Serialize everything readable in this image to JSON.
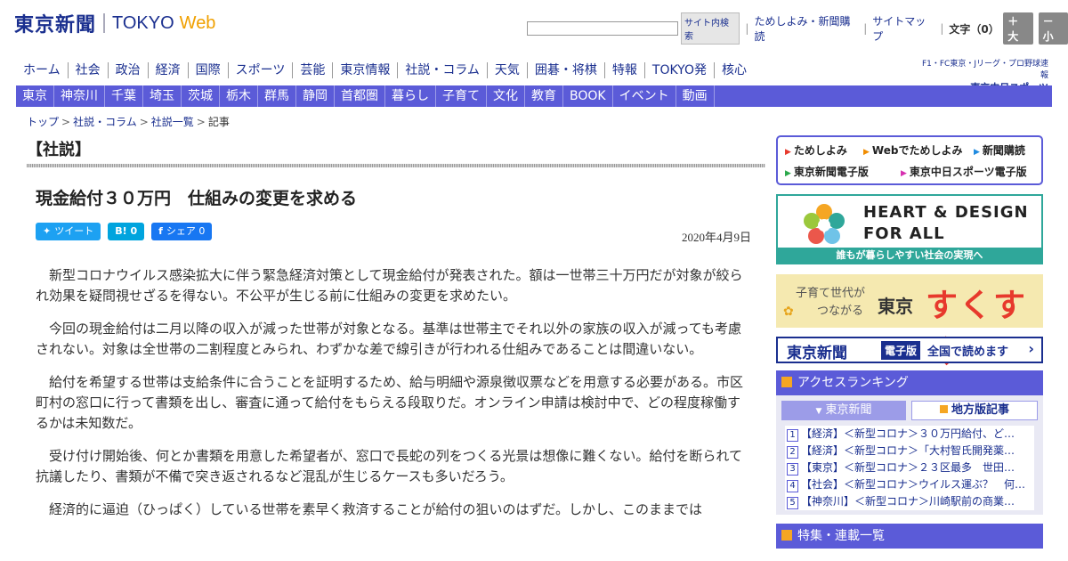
{
  "header": {
    "logo_jp": "東京新聞",
    "logo_tokyo": "TOKYO",
    "logo_web": "Web",
    "search": {
      "placeholder": "",
      "button": "サイト内検索"
    },
    "links": [
      "ためしよみ・新聞購読",
      "サイトマップ"
    ],
    "font_size": {
      "label": "文字（0）",
      "bigger": "＋大",
      "smaller": "－小"
    }
  },
  "main_nav": [
    "ホーム",
    "社会",
    "政治",
    "経済",
    "国際",
    "スポーツ",
    "芸能",
    "東京情報",
    "社説・コラム",
    "天気",
    "囲碁・将棋",
    "特報",
    "TOKYO発",
    "核心"
  ],
  "sports_link": {
    "top": "F1・FC東京・Jリーグ・プロ野球速報",
    "bottom": "東京中日スポーツ"
  },
  "region_nav": [
    "東京",
    "神奈川",
    "千葉",
    "埼玉",
    "茨城",
    "栃木",
    "群馬",
    "静岡",
    "首都圏",
    "暮らし",
    "子育て",
    "文化",
    "教育",
    "BOOK",
    "イベント",
    "動画"
  ],
  "breadcrumb": [
    "トップ",
    "社説・コラム",
    "社説一覧",
    "記事"
  ],
  "article": {
    "section": "【社説】",
    "headline": "現金給付３０万円　仕組みの変更を求める",
    "date": "2020年4月9日",
    "share": {
      "tweet": "ツイート",
      "hatena": "B!",
      "hatena_count": "0",
      "facebook": "シェア",
      "facebook_count": "0"
    },
    "paragraphs": [
      "新型コロナウイルス感染拡大に伴う緊急経済対策として現金給付が発表された。額は一世帯三十万円だが対象が絞られ効果を疑問視せざるを得ない。不公平が生じる前に仕組みの変更を求めたい。",
      "今回の現金給付は二月以降の収入が減った世帯が対象となる。基準は世帯主でそれ以外の家族の収入が減っても考慮されない。対象は全世帯の二割程度とみられ、わずかな差で線引きが行われる仕組みであることは間違いない。",
      "給付を希望する世帯は支給条件に合うことを証明するため、給与明細や源泉徴収票などを用意する必要がある。市区町村の窓口に行って書類を出し、審査に通って給付をもらえる段取りだ。オンライン申請は検討中で、どの程度稼働するかは未知数だ。",
      "受け付け開始後、何とか書類を用意した希望者が、窓口で長蛇の列をつくる光景は想像に難くない。給付を断られて抗議したり、書類が不備で突き返されるなど混乱が生じるケースも多いだろう。",
      "経済的に逼迫（ひっぱく）している世帯を素早く救済することが給付の狙いのはずだ。しかし、このままでは"
    ]
  },
  "sidebar": {
    "quicklinks": [
      {
        "label": "ためしよみ",
        "color": "#e7392c"
      },
      {
        "label": "Webでためしよみ",
        "color": "#f08c00"
      },
      {
        "label": "新聞購読",
        "color": "#1f8ae0"
      },
      {
        "label": "東京新聞電子版",
        "color": "#2aa84a"
      },
      {
        "label": "東京中日スポーツ電子版",
        "color": "#d62fb0"
      }
    ],
    "heart_banner": {
      "line1": "HEART & DESIGN",
      "line2": "FOR ALL",
      "caption": "誰もが暮らしやすい社会の実現へ"
    },
    "sukusuku": {
      "line1": "子育て世代が",
      "line2": "つながる",
      "tokyo": "東京",
      "big": "すくすく"
    },
    "digital": {
      "name": "東京新聞",
      "tag": "電子版",
      "cta": "全国で読めます"
    },
    "ranking": {
      "title": "アクセスランキング",
      "tabs": [
        "東京新聞",
        "地方版記事"
      ],
      "items": [
        {
          "num": "1",
          "text": "【経済】＜新型コロナ＞３０万円給付、ど…"
        },
        {
          "num": "2",
          "text": "【経済】＜新型コロナ＞「大村智氏開発薬…"
        },
        {
          "num": "3",
          "text": "【東京】＜新型コロナ＞２３区最多　世田…"
        },
        {
          "num": "4",
          "text": "【社会】＜新型コロナ＞ウイルス運ぶ？　何…"
        },
        {
          "num": "5",
          "text": "【神奈川】＜新型コロナ＞川崎駅前の商業…"
        }
      ]
    },
    "features": {
      "title": "特集・連載一覧"
    }
  }
}
